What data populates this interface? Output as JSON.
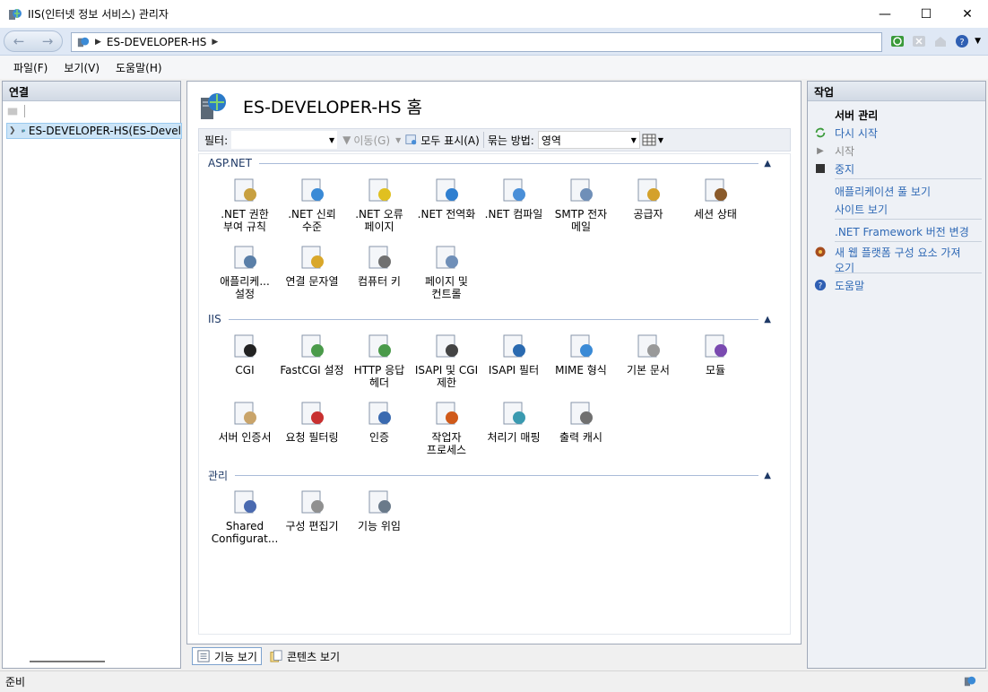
{
  "window": {
    "title": "IIS(인터넷 정보 서비스) 관리자"
  },
  "address": {
    "segment": "ES-DEVELOPER-HS"
  },
  "menu": [
    "파일(F)",
    "보기(V)",
    "도움말(H)"
  ],
  "connections": {
    "header": "연결",
    "tree_node": "ES-DEVELOPER-HS(ES-Devel"
  },
  "center": {
    "title": "ES-DEVELOPER-HS 홈",
    "filter_label": "필터:",
    "go_label": "이동(G)",
    "show_all_label": "모두 표시(A)",
    "group_by_label": "묶는 방법:",
    "group_by_value": "영역",
    "groups": [
      {
        "name": "ASP.NET",
        "items": [
          ".NET 권한\n부여 규칙",
          ".NET 신뢰\n수준",
          ".NET 오류\n페이지",
          ".NET 전역화",
          ".NET 컴파일",
          "SMTP 전자\n메일",
          "공급자",
          "세션 상태",
          "애플리케...\n설정",
          "연결 문자열",
          "컴퓨터 키",
          "페이지 및\n컨트롤"
        ]
      },
      {
        "name": "IIS",
        "items": [
          "CGI",
          "FastCGI 설정",
          "HTTP 응답\n헤더",
          "ISAPI 및 CGI\n제한",
          "ISAPI 필터",
          "MIME 형식",
          "기본 문서",
          "모듈",
          "서버 인증서",
          "요청 필터링",
          "인증",
          "작업자\n프로세스",
          "처리기 매핑",
          "출력 캐시"
        ]
      },
      {
        "name": "관리",
        "items": [
          "Shared\nConfigurat...",
          "구성 편집기",
          "기능 위임"
        ]
      }
    ]
  },
  "view_tabs": {
    "features": "기능 보기",
    "content": "콘텐츠 보기"
  },
  "actions": {
    "header": "작업",
    "server_manage": "서버 관리",
    "restart": "다시 시작",
    "start": "시작",
    "stop": "중지",
    "app_pools": "애플리케이션 풀 보기",
    "sites": "사이트 보기",
    "net_version": ".NET Framework 버전 변경",
    "get_web": "새 웹 플랫폼 구성 요소 가져\n오기",
    "help": "도움말"
  },
  "status": {
    "text": "준비"
  }
}
